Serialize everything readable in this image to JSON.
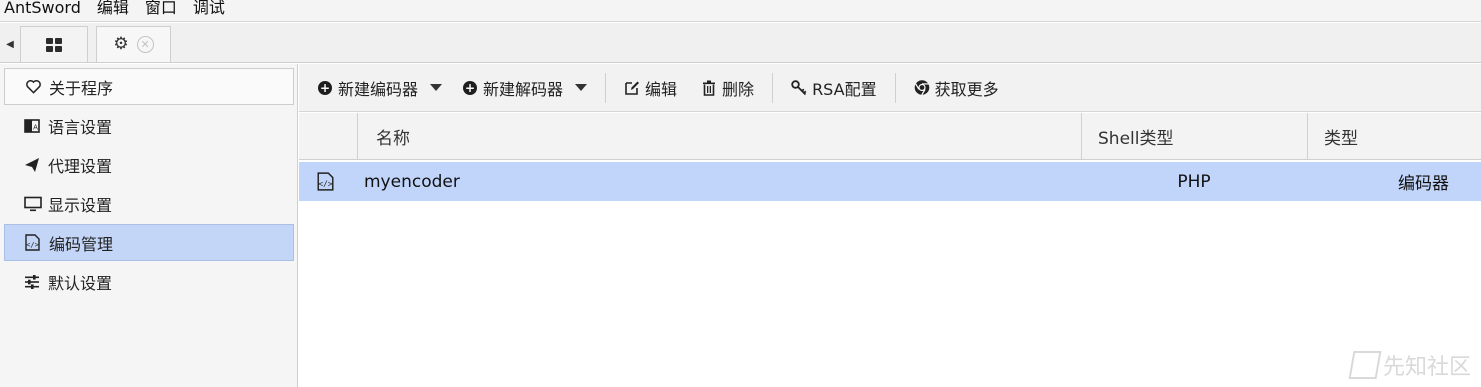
{
  "menu": {
    "items": [
      "AntSword",
      "编辑",
      "窗口",
      "调试"
    ]
  },
  "tabs": {
    "home_icon": "grid-icon",
    "settings_icon": "gear-icon",
    "close_icon": "close-icon",
    "scroll_left": "◀"
  },
  "sidebar": {
    "items": [
      {
        "icon": "heart-icon",
        "label": "关于程序"
      },
      {
        "icon": "language-icon",
        "label": "语言设置"
      },
      {
        "icon": "paper-plane-icon",
        "label": "代理设置"
      },
      {
        "icon": "monitor-icon",
        "label": "显示设置"
      },
      {
        "icon": "code-file-icon",
        "label": "编码管理",
        "active": true
      },
      {
        "icon": "sliders-icon",
        "label": "默认设置"
      }
    ]
  },
  "toolbar": {
    "new_encoder": "新建编码器",
    "new_decoder": "新建解码器",
    "edit": "编辑",
    "delete": "删除",
    "rsa": "RSA配置",
    "more": "获取更多"
  },
  "table": {
    "columns": {
      "name": "名称",
      "shell_type": "Shell类型",
      "type": "类型"
    },
    "rows": [
      {
        "icon": "code-file-icon",
        "name": "myencoder",
        "shell_type": "PHP",
        "type": "编码器",
        "selected": true
      }
    ]
  },
  "watermark": {
    "text": "先知社区"
  },
  "colors": {
    "selection": "#c1d4fa",
    "toolbar_bg": "#f2f2f2",
    "sidebar_bg": "#f5f5f5"
  }
}
